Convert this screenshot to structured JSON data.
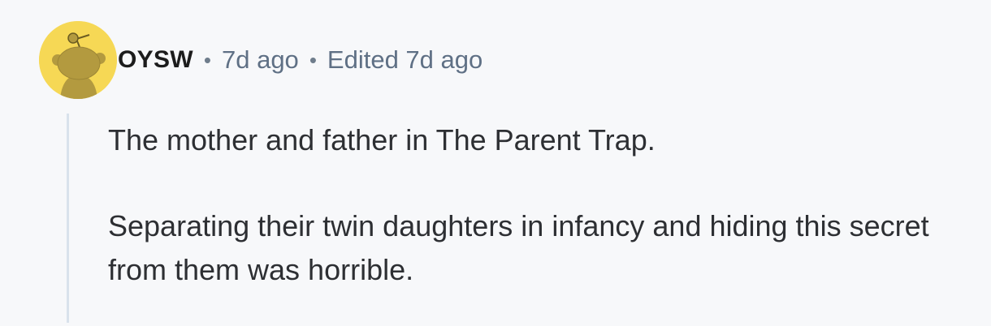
{
  "comment": {
    "author": "OYSW",
    "separator": "•",
    "posted_time": "7d ago",
    "edited_label": "Edited 7d ago",
    "paragraphs": [
      "The mother and father in The Parent Trap.",
      "Separating their twin daughters in infancy and hiding this secret from them was horrible."
    ]
  },
  "avatar": {
    "icon": "snoo-avatar-icon",
    "background_color": "#f6d855",
    "figure_color": "#b39a3f"
  }
}
